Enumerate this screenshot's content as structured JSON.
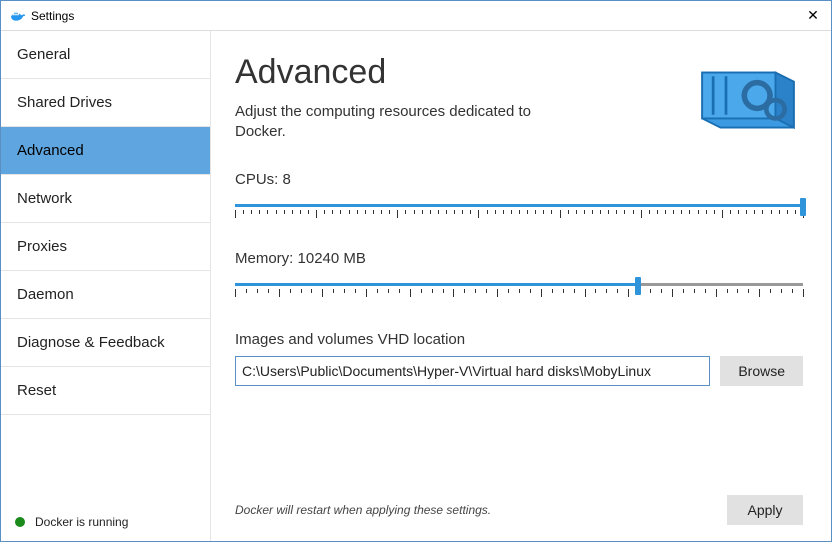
{
  "window": {
    "title": "Settings"
  },
  "sidebar": {
    "items": [
      {
        "label": "General",
        "active": false
      },
      {
        "label": "Shared Drives",
        "active": false
      },
      {
        "label": "Advanced",
        "active": true
      },
      {
        "label": "Network",
        "active": false
      },
      {
        "label": "Proxies",
        "active": false
      },
      {
        "label": "Daemon",
        "active": false
      },
      {
        "label": "Diagnose & Feedback",
        "active": false
      },
      {
        "label": "Reset",
        "active": false
      }
    ],
    "status": {
      "label": "Docker is running",
      "color": "#1a8a1a"
    }
  },
  "content": {
    "heading": "Advanced",
    "subtitle": "Adjust the computing resources dedicated to Docker.",
    "cpus": {
      "label": "CPUs: 8",
      "value": 8,
      "min": 1,
      "max": 8,
      "fill_percent": 100
    },
    "memory": {
      "label": "Memory: 10240 MB",
      "value": 10240,
      "min": 1024,
      "max": 14336,
      "fill_percent": 71
    },
    "vhd": {
      "label": "Images and volumes VHD location",
      "value": "C:\\Users\\Public\\Documents\\Hyper-V\\Virtual hard disks\\MobyLinux",
      "browse_label": "Browse"
    },
    "footer_note": "Docker will restart when applying these settings.",
    "apply_label": "Apply"
  },
  "colors": {
    "accent": "#2f94da",
    "sidebar_active": "#5fa6e0",
    "border_focus": "#5a8fc4"
  }
}
